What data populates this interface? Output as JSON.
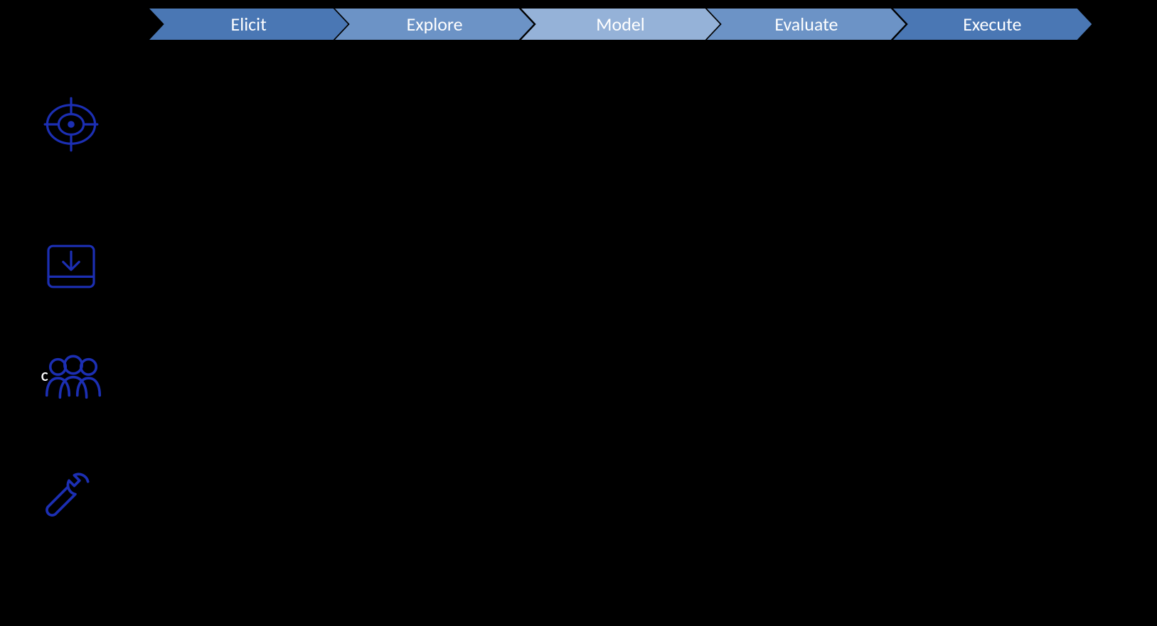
{
  "chevrons": {
    "items": [
      {
        "label": "Elicit",
        "fill": "#4a77b4"
      },
      {
        "label": "Explore",
        "fill": "#6c93c6"
      },
      {
        "label": "Model",
        "fill": "#95b2d8"
      },
      {
        "label": "Evaluate",
        "fill": "#6c93c6"
      },
      {
        "label": "Execute",
        "fill": "#4a77b4"
      }
    ]
  },
  "side_icons": {
    "stroke_color": "#1c2fb3",
    "c_overlay": "C"
  }
}
